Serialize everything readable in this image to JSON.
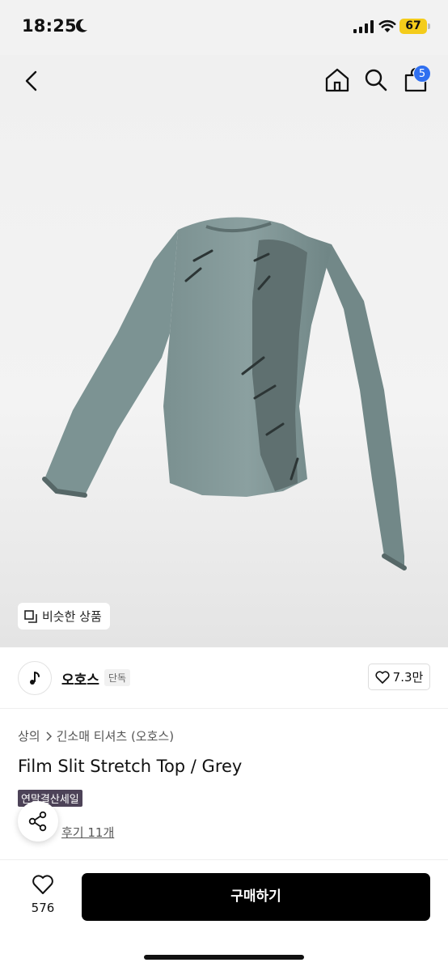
{
  "status_bar": {
    "time": "18:25",
    "battery": "67"
  },
  "header": {
    "cart_count": "5"
  },
  "hero": {
    "similar_label": "비슷한 상품"
  },
  "brand": {
    "name": "오호스",
    "tag": "단독",
    "likes": "7.3만"
  },
  "product": {
    "breadcrumb": [
      "상의",
      "긴소매 티셔츠 (오호스)"
    ],
    "title": "Film Slit Stretch Top / Grey",
    "sale_tag": "연말결산세일",
    "reviews": "후기 11개"
  },
  "bottom": {
    "wish_count": "576",
    "buy_label": "구매하기"
  },
  "colors": {
    "accent_badge": "#2f6ff0",
    "sale_tag_bg": "#4d4358",
    "buy_bg": "#000000",
    "shirt": "#7e9494"
  }
}
